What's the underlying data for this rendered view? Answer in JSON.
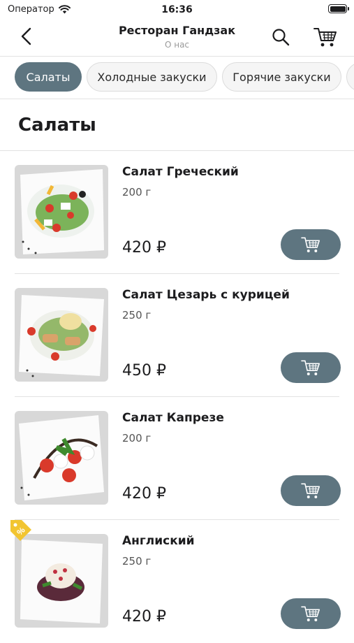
{
  "status": {
    "carrier": "Оператор",
    "time": "16:36"
  },
  "header": {
    "title": "Ресторан Гандзак",
    "subtitle": "О нас"
  },
  "tabs": [
    {
      "label": "Салаты",
      "active": true
    },
    {
      "label": "Холодные закуски",
      "active": false
    },
    {
      "label": "Горячие закуски",
      "active": false
    }
  ],
  "section": {
    "title": "Салаты"
  },
  "items": [
    {
      "name": "Салат Греческий",
      "weight": "200 г",
      "price": "420 ₽",
      "discount": false
    },
    {
      "name": "Салат Цезарь с курицей",
      "weight": "250 г",
      "price": "450 ₽",
      "discount": false
    },
    {
      "name": "Салат Капрезе",
      "weight": "200 г",
      "price": "420 ₽",
      "discount": false
    },
    {
      "name": "Англиский",
      "weight": "250 г",
      "price": "420 ₽",
      "discount": true
    }
  ],
  "icons": {
    "wifi": "wifi-icon",
    "battery": "battery-icon",
    "back": "chevron-left-icon",
    "search": "search-icon",
    "cart": "cart-icon",
    "discount": "percent-tag-icon"
  },
  "colors": {
    "accent": "#5e7580",
    "tab_idle": "#f5f5f5",
    "badge": "#f2c531"
  }
}
